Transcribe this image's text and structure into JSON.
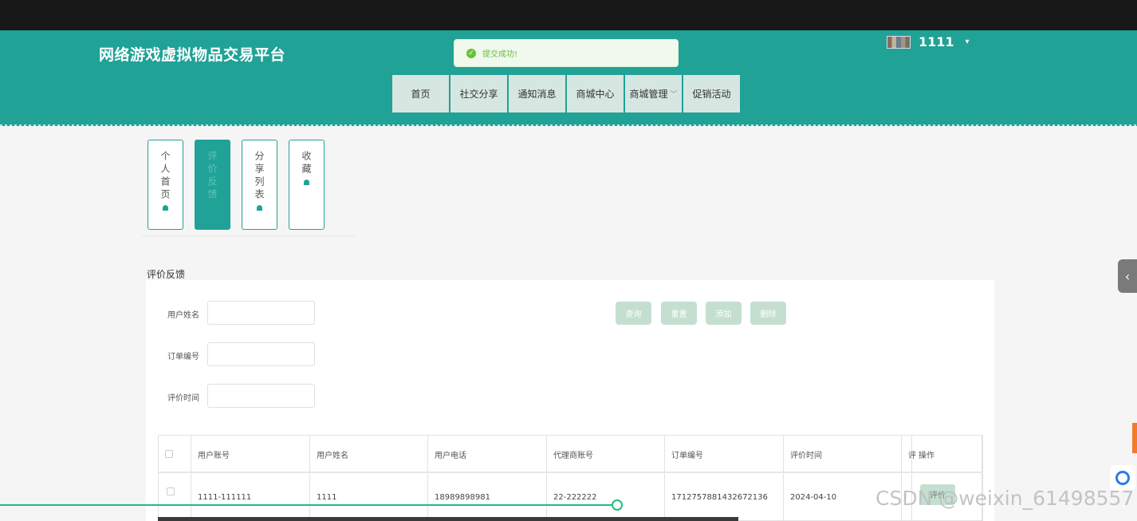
{
  "site": {
    "title": "网络游戏虚拟物品交易平台"
  },
  "toast": {
    "message": "提交成功!"
  },
  "user": {
    "name": "1111",
    "caret": "▾"
  },
  "nav": {
    "items": [
      "首页",
      "社交分享",
      "通知消息",
      "商城中心",
      "商城管理",
      "促销活动"
    ],
    "dropdown_chevron": "﹀"
  },
  "side_tabs": [
    {
      "label": "个人首页",
      "icon": "☗",
      "active": false
    },
    {
      "label": "评价反馈",
      "icon": "",
      "active": true
    },
    {
      "label": "分享列表",
      "icon": "☗",
      "active": false
    },
    {
      "label": "收藏",
      "icon": "☗",
      "active": false
    }
  ],
  "page": {
    "title": "评价反馈"
  },
  "search": {
    "fields": [
      {
        "label": "用户姓名",
        "value": ""
      },
      {
        "label": "订单编号",
        "value": ""
      },
      {
        "label": "评价时间",
        "value": ""
      }
    ],
    "buttons": [
      "查询",
      "重置",
      "添加",
      "删除"
    ]
  },
  "table": {
    "headers": [
      "用户账号",
      "用户姓名",
      "用户电话",
      "代理商账号",
      "订单编号",
      "评价时间",
      "评",
      "操作"
    ],
    "rows": [
      {
        "account": "1111-111111",
        "name": "1111",
        "phone": "18989898981",
        "agent": "22-222222",
        "order": "1712757881432672136",
        "time": "2024-04-10",
        "clip": "I",
        "action": "评价"
      }
    ]
  },
  "side_handle": {
    "icon": "‹"
  },
  "watermark": "CSDN @weixin_61498557",
  "colors": {
    "primary": "#20a297",
    "button": "#c4dfd0",
    "success": "#67c23a"
  }
}
